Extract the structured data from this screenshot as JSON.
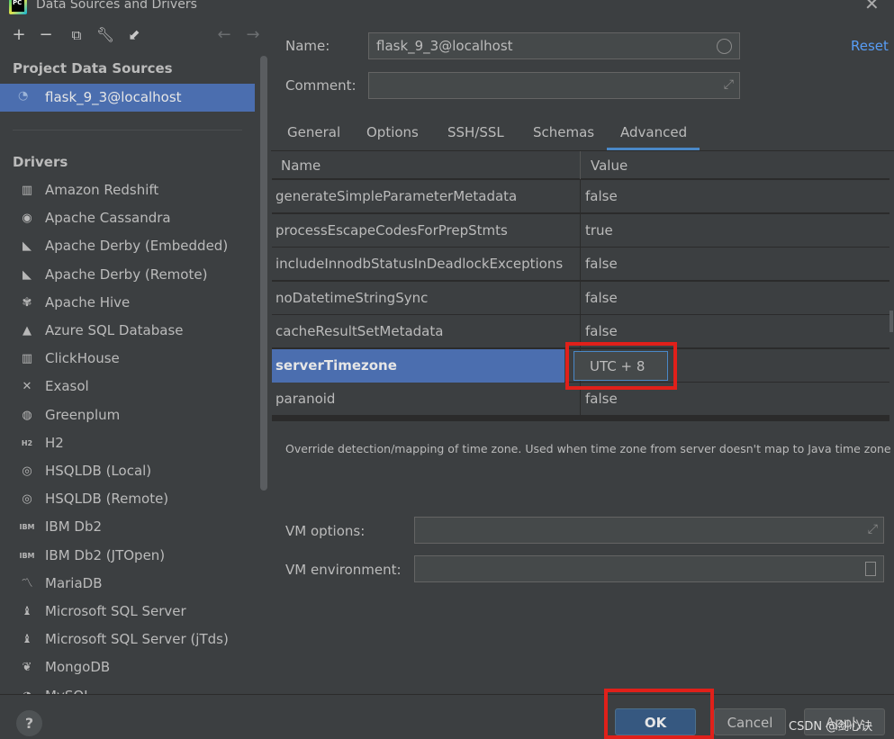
{
  "window": {
    "title": "Data Sources and Drivers"
  },
  "left": {
    "project_title": "Project Data Sources",
    "data_source": "flask_9_3@localhost",
    "drivers_title": "Drivers",
    "drivers": [
      {
        "label": "Amazon Redshift",
        "icon": "▥"
      },
      {
        "label": "Apache Cassandra",
        "icon": "◉"
      },
      {
        "label": "Apache Derby (Embedded)",
        "icon": "◣"
      },
      {
        "label": "Apache Derby (Remote)",
        "icon": "◣"
      },
      {
        "label": "Apache Hive",
        "icon": "✾"
      },
      {
        "label": "Azure SQL Database",
        "icon": "▲"
      },
      {
        "label": "ClickHouse",
        "icon": "▥"
      },
      {
        "label": "Exasol",
        "icon": "✕"
      },
      {
        "label": "Greenplum",
        "icon": "◍"
      },
      {
        "label": "H2",
        "icon": "H2"
      },
      {
        "label": "HSQLDB (Local)",
        "icon": "◎"
      },
      {
        "label": "HSQLDB (Remote)",
        "icon": "◎"
      },
      {
        "label": "IBM Db2",
        "icon": "IBM"
      },
      {
        "label": "IBM Db2 (JTOpen)",
        "icon": "IBM"
      },
      {
        "label": "MariaDB",
        "icon": "〽"
      },
      {
        "label": "Microsoft SQL Server",
        "icon": "♝"
      },
      {
        "label": "Microsoft SQL Server (jTds)",
        "icon": "♝"
      },
      {
        "label": "MongoDB",
        "icon": "❦"
      },
      {
        "label": "MySQL",
        "icon": "◔"
      }
    ]
  },
  "right": {
    "name_label": "Name:",
    "name_value": "flask_9_3@localhost",
    "comment_label": "Comment:",
    "comment_value": "",
    "reset": "Reset",
    "tabs": [
      "General",
      "Options",
      "SSH/SSL",
      "Schemas",
      "Advanced"
    ],
    "active_tab": "Advanced",
    "table_headers": {
      "name": "Name",
      "value": "Value"
    },
    "rows": [
      {
        "name": "generateSimpleParameterMetadata",
        "value": "false"
      },
      {
        "name": "processEscapeCodesForPrepStmts",
        "value": "true"
      },
      {
        "name": "includeInnodbStatusInDeadlockExceptions",
        "value": "false"
      },
      {
        "name": "noDatetimeStringSync",
        "value": "false"
      },
      {
        "name": "cacheResultSetMetadata",
        "value": "false"
      },
      {
        "name": "serverTimezone",
        "value": "UTC + 8"
      },
      {
        "name": "paranoid",
        "value": "false"
      }
    ],
    "description": "Override detection/mapping of time zone. Used when time zone from server doesn't map to Java time zone",
    "vm_options_label": "VM options:",
    "vm_environment_label": "VM environment:"
  },
  "bottom": {
    "help": "?",
    "ok": "OK",
    "cancel": "Cancel",
    "apply": "Apply",
    "watermark": "CSDN @剑心诀"
  },
  "colors": {
    "selection": "#4b6eaf",
    "accent_link": "#589df6",
    "highlight_red": "#e0201a",
    "background": "#3c3f41"
  }
}
